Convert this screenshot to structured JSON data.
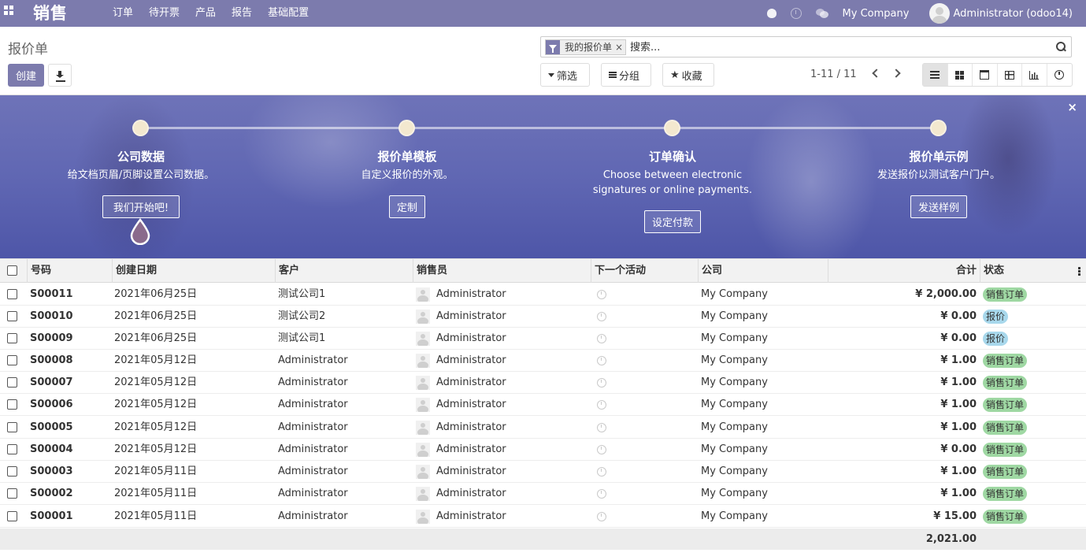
{
  "navbar": {
    "app_name": "销售",
    "menu": [
      "订单",
      "待开票",
      "产品",
      "报告",
      "基础配置"
    ],
    "company": "My Company",
    "user": "Administrator (odoo14)"
  },
  "control_panel": {
    "breadcrumb": "报价单",
    "create_label": "创建",
    "search": {
      "facet_label": "我的报价单",
      "facet_remove": "×",
      "placeholder": "搜索..."
    },
    "filters_label": "筛选",
    "groupby_label": "分组",
    "favorites_label": "收藏",
    "pager": "1-11 / 11",
    "views": [
      "list-view-icon",
      "kanban-view-icon",
      "calendar-view-icon",
      "pivot-view-icon",
      "graph-view-icon",
      "activity-view-icon"
    ],
    "active_view": "list"
  },
  "banner": {
    "close": "×",
    "steps": [
      {
        "title": "公司数据",
        "description": "给文档页眉/页脚设置公司数据。",
        "button": "我们开始吧!"
      },
      {
        "title": "报价单模板",
        "description": "自定义报价的外观。",
        "button": "定制"
      },
      {
        "title": "订单确认",
        "description": "Choose between electronic signatures or online payments.",
        "button": "设定付款"
      },
      {
        "title": "报价单示例",
        "description": "发送报价以测试客户门户。",
        "button": "发送样例"
      }
    ]
  },
  "table": {
    "columns": [
      "号码",
      "创建日期",
      "客户",
      "销售员",
      "下一个活动",
      "公司",
      "合计",
      "状态"
    ],
    "rows": [
      {
        "number": "S00011",
        "date": "2021年06月25日",
        "customer": "测试公司1",
        "salesperson": "Administrator",
        "company": "My Company",
        "total": "¥ 2,000.00",
        "state": "销售订单",
        "state_type": "sale"
      },
      {
        "number": "S00010",
        "date": "2021年06月25日",
        "customer": "测试公司2",
        "salesperson": "Administrator",
        "company": "My Company",
        "total": "¥ 0.00",
        "state": "报价",
        "state_type": "quote"
      },
      {
        "number": "S00009",
        "date": "2021年06月25日",
        "customer": "测试公司1",
        "salesperson": "Administrator",
        "company": "My Company",
        "total": "¥ 0.00",
        "state": "报价",
        "state_type": "quote"
      },
      {
        "number": "S00008",
        "date": "2021年05月12日",
        "customer": "Administrator",
        "salesperson": "Administrator",
        "company": "My Company",
        "total": "¥ 1.00",
        "state": "销售订单",
        "state_type": "sale"
      },
      {
        "number": "S00007",
        "date": "2021年05月12日",
        "customer": "Administrator",
        "salesperson": "Administrator",
        "company": "My Company",
        "total": "¥ 1.00",
        "state": "销售订单",
        "state_type": "sale"
      },
      {
        "number": "S00006",
        "date": "2021年05月12日",
        "customer": "Administrator",
        "salesperson": "Administrator",
        "company": "My Company",
        "total": "¥ 1.00",
        "state": "销售订单",
        "state_type": "sale"
      },
      {
        "number": "S00005",
        "date": "2021年05月12日",
        "customer": "Administrator",
        "salesperson": "Administrator",
        "company": "My Company",
        "total": "¥ 1.00",
        "state": "销售订单",
        "state_type": "sale"
      },
      {
        "number": "S00004",
        "date": "2021年05月12日",
        "customer": "Administrator",
        "salesperson": "Administrator",
        "company": "My Company",
        "total": "¥ 0.00",
        "state": "销售订单",
        "state_type": "sale"
      },
      {
        "number": "S00003",
        "date": "2021年05月11日",
        "customer": "Administrator",
        "salesperson": "Administrator",
        "company": "My Company",
        "total": "¥ 1.00",
        "state": "销售订单",
        "state_type": "sale"
      },
      {
        "number": "S00002",
        "date": "2021年05月11日",
        "customer": "Administrator",
        "salesperson": "Administrator",
        "company": "My Company",
        "total": "¥ 1.00",
        "state": "销售订单",
        "state_type": "sale"
      },
      {
        "number": "S00001",
        "date": "2021年05月11日",
        "customer": "Administrator",
        "salesperson": "Administrator",
        "company": "My Company",
        "total": "¥ 15.00",
        "state": "销售订单",
        "state_type": "sale"
      }
    ],
    "footer_total": "2,021.00"
  },
  "colors": {
    "brand": "#7c7bad",
    "sale_badge": "#9fd8a3",
    "quote_badge": "#a8d8ec"
  }
}
